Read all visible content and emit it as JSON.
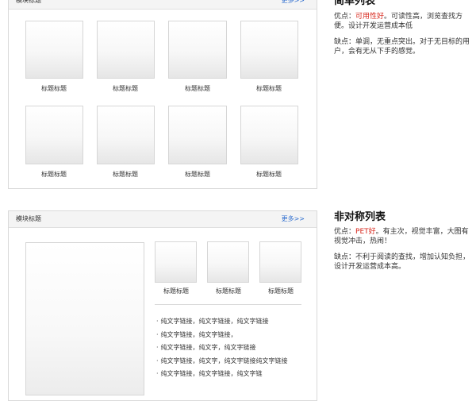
{
  "panel_top": {
    "title": "模块标题",
    "more": "更多>>",
    "captions": [
      "标题标题",
      "标题标题",
      "标题标题",
      "标题标题",
      "标题标题",
      "标题标题",
      "标题标题",
      "标题标题"
    ]
  },
  "panel_bottom": {
    "title": "模块标题",
    "more": "更多>>",
    "captions": [
      "标题标题",
      "标题标题",
      "标题标题"
    ],
    "bullet": "·",
    "links": [
      "纯文字链接，纯文字链接，纯文字链接",
      "纯文字链接，纯文字链接，",
      "纯文字链接，纯文字，纯文字链接",
      "纯文字链接，纯文字，纯文字链接纯文字链接",
      "纯文字链接，纯文字链接，纯文字链"
    ]
  },
  "desc_top": {
    "title": "简单列表",
    "pros_prefix": "优点：",
    "pros_highlight": "可用性好",
    "pros_rest": "。可读性高，浏览查找方便。设计开发运营成本低",
    "cons": "缺点：单调，无重点突出。对于无目标的用户，会有无从下手的感觉。"
  },
  "desc_bottom": {
    "title": "非对称列表",
    "pros_prefix": "优点：",
    "pros_highlight": "PET好",
    "pros_rest": "。有主次，视觉丰富，大图有视觉冲击，热闹！",
    "cons": "缺点：不利于阅读的查找，增加认知负担，设计开发运营成本高。"
  },
  "colors": {
    "link_blue": "#2f6ecf",
    "highlight_red": "#d7261b",
    "border_gray": "#d9d9d9"
  }
}
